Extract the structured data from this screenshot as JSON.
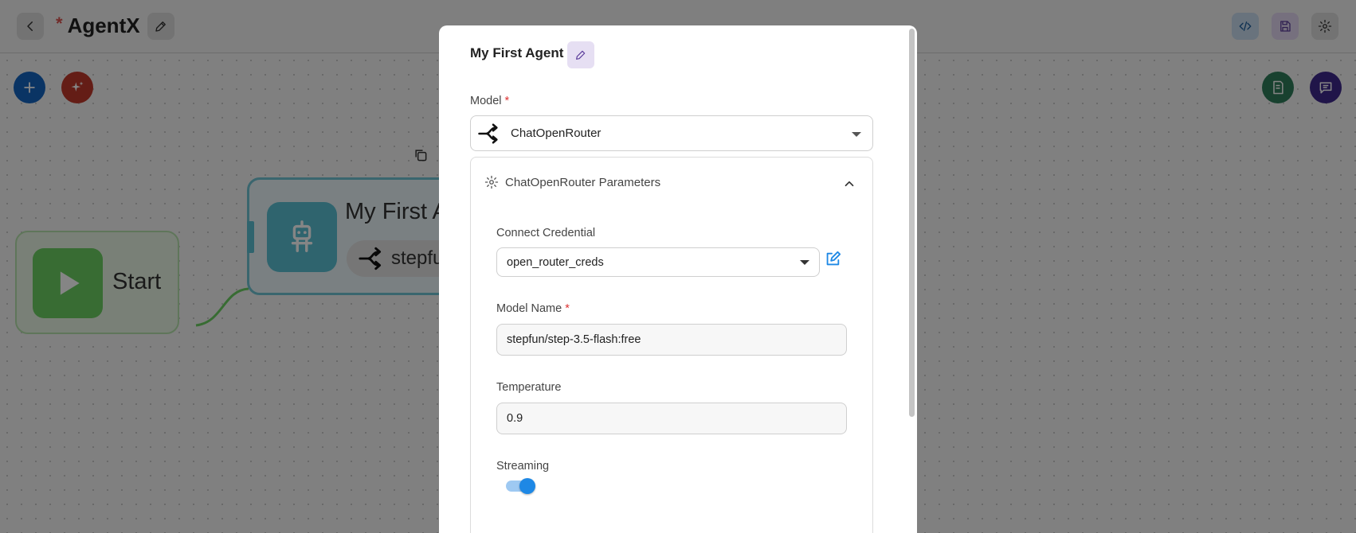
{
  "header": {
    "unsaved_marker": "*",
    "title": "AgentX"
  },
  "canvas": {
    "start_node": {
      "label": "Start"
    },
    "agent_node": {
      "title": "My First Agent",
      "chip_text": "stepfun"
    }
  },
  "modal": {
    "title": "My First Agent",
    "model": {
      "label": "Model",
      "required_marker": "*",
      "selected": "ChatOpenRouter"
    },
    "parameters": {
      "heading": "ChatOpenRouter Parameters",
      "expanded": true,
      "credential": {
        "label": "Connect Credential",
        "value": "open_router_creds"
      },
      "model_name": {
        "label": "Model Name",
        "required_marker": "*",
        "value": "stepfun/step-3.5-flash:free"
      },
      "temperature": {
        "label": "Temperature",
        "value": "0.9"
      },
      "streaming": {
        "label": "Streaming",
        "enabled": true
      }
    }
  },
  "colors": {
    "accent_blue": "#1e88e5",
    "add_button": "#1565c0",
    "sparkle_button": "#c0392b",
    "doc_button": "#2e7d5b",
    "chat_button": "#3f2a8c",
    "start_green": "#6bcf62",
    "agent_teal": "#5bc0d3"
  },
  "icons": [
    "back-icon",
    "pencil-icon",
    "code-icon",
    "save-icon",
    "gear-icon",
    "plus-icon",
    "sparkle-icon",
    "document-icon",
    "chat-icon",
    "copy-icon",
    "play-icon",
    "robot-icon",
    "openrouter-icon",
    "chevron-up-icon",
    "edit-square-icon"
  ]
}
